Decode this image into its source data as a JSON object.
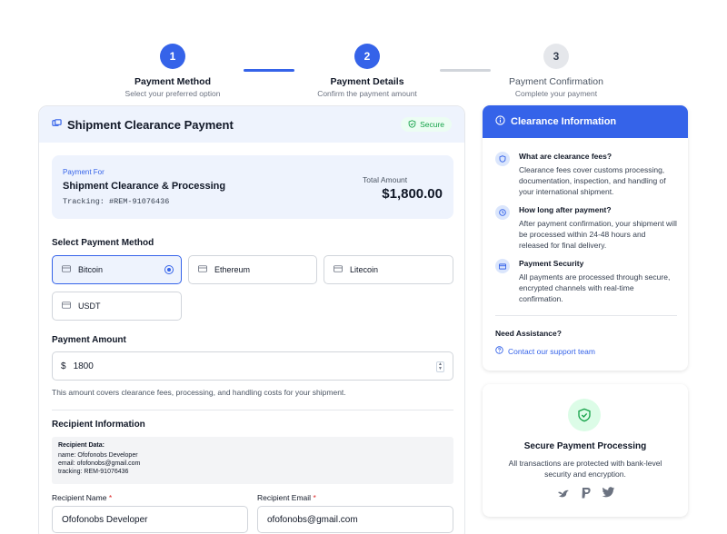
{
  "stepper": {
    "steps": [
      {
        "number": "1",
        "title": "Payment Method",
        "subtitle": "Select your preferred option",
        "state": "active"
      },
      {
        "number": "2",
        "title": "Payment Details",
        "subtitle": "Confirm the payment amount",
        "state": "active"
      },
      {
        "number": "3",
        "title": "Payment Confirmation",
        "subtitle": "Complete your payment",
        "state": "inactive"
      }
    ]
  },
  "main": {
    "title": "Shipment Clearance Payment",
    "secure_badge": "Secure",
    "summary": {
      "for_label": "Payment For",
      "for_title": "Shipment Clearance & Processing",
      "tracking": "Tracking: #REM-91076436",
      "total_label": "Total Amount",
      "total_value": "$1,800.00"
    },
    "method_section_label": "Select Payment Method",
    "methods": [
      {
        "label": "Bitcoin",
        "selected": true
      },
      {
        "label": "Ethereum",
        "selected": false
      },
      {
        "label": "Litecoin",
        "selected": false
      },
      {
        "label": "USDT",
        "selected": false
      }
    ],
    "amount_section_label": "Payment Amount",
    "amount": {
      "currency": "$",
      "value": "1800"
    },
    "amount_help": "This amount covers clearance fees, processing, and handling costs for your shipment.",
    "recipient_section_label": "Recipient Information",
    "recipient_data": {
      "title": "Recipient Data:",
      "lines": [
        "name: Ofofonobs Developer",
        "email: ofofonobs@gmail.com",
        "tracking: REM-91076436"
      ]
    },
    "recipient_name": {
      "label": "Recipient Name",
      "required": "*",
      "value": "Ofofonobs Developer"
    },
    "recipient_email": {
      "label": "Recipient Email",
      "required": "*",
      "value": "ofofonobs@gmail.com"
    }
  },
  "info": {
    "title": "Clearance Information",
    "faqs": [
      {
        "icon": "shield-icon",
        "q": "What are clearance fees?",
        "a": "Clearance fees cover customs processing, documentation, inspection, and handling of your international shipment."
      },
      {
        "icon": "clock-icon",
        "q": "How long after payment?",
        "a": "After payment confirmation, your shipment will be processed within 24-48 hours and released for final delivery."
      },
      {
        "icon": "credit-card-icon",
        "q": "Payment Security",
        "a": "All payments are processed through secure, encrypted channels with real-time confirmation."
      }
    ],
    "assist_title": "Need Assistance?",
    "assist_link": "Contact our support team"
  },
  "secure_card": {
    "title": "Secure Payment Processing",
    "desc": "All transactions are protected with bank-level security and encryption.",
    "brands": [
      "bird-icon",
      "paypal-icon",
      "twitter-icon"
    ]
  },
  "colors": {
    "accent": "#3563e9",
    "success": "#16a34a",
    "required": "#dc2626"
  }
}
